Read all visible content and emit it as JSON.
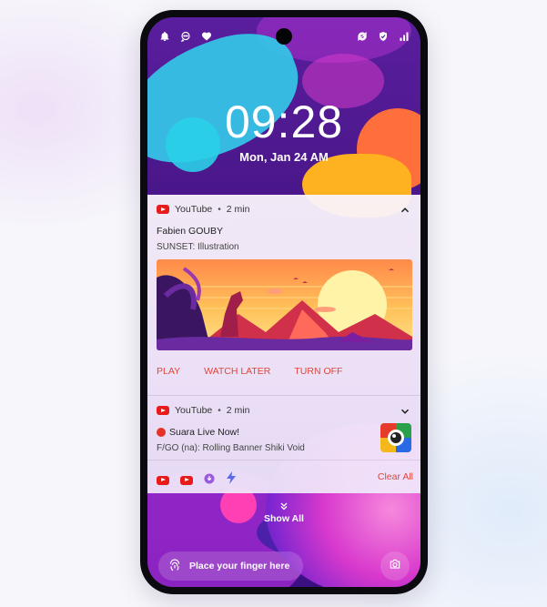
{
  "status_bar": {
    "left_icons": [
      "bell-icon",
      "chat-icon",
      "heart-icon"
    ],
    "right_icons": [
      "sync-icon",
      "shield-check-icon",
      "signal-icon"
    ]
  },
  "lock": {
    "time": "09:28",
    "date": "Mon, Jan 24 AM"
  },
  "notifications": [
    {
      "app": "YouTube",
      "separator": "•",
      "age": "2 min",
      "title": "Fabien GOUBY",
      "text": "SUNSET: Illustration",
      "actions": [
        "PLAY",
        "WATCH LATER",
        "TURN OFF"
      ]
    },
    {
      "app": "YouTube",
      "separator": "•",
      "age": "2 min",
      "title": "Suara Live Now!",
      "text": "F/GO (na): Rolling Banner Shiki Void"
    }
  ],
  "footer": {
    "clear_label": "Clear All",
    "app_icons": [
      "youtube-icon",
      "youtube-icon",
      "download-icon",
      "bolt-icon"
    ]
  },
  "show_all": "Show All",
  "fingerprint": "Place your finger here",
  "colors": {
    "accent": "#e0463a",
    "youtube": "#e81b1b"
  }
}
